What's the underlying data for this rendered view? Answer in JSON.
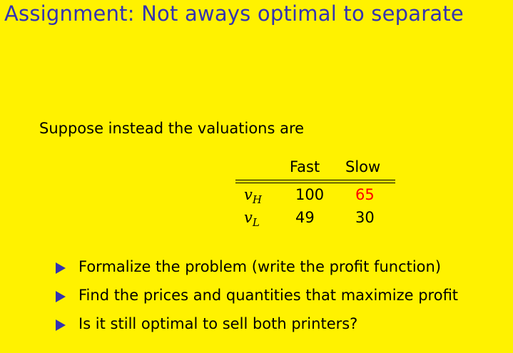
{
  "title": "Assignment: Not aways optimal to separate",
  "intro": "Suppose instead the valuations are",
  "table": {
    "headers": [
      "Fast",
      "Slow"
    ],
    "rows": [
      {
        "label": "v",
        "subscript": "H",
        "fast": "100",
        "slow": "65"
      },
      {
        "label": "v",
        "subscript": "L",
        "fast": "49",
        "slow": "30"
      }
    ],
    "highlight_color": "#ff0000"
  },
  "bullets": [
    "Formalize the problem (write the profit function)",
    "Find the prices and quantities that maximize profit",
    "Is it still optimal to sell both printers?"
  ],
  "colors": {
    "background": "#fff200",
    "accent": "#3333b2"
  },
  "icons": {
    "bullet": "triangle-right-icon"
  }
}
